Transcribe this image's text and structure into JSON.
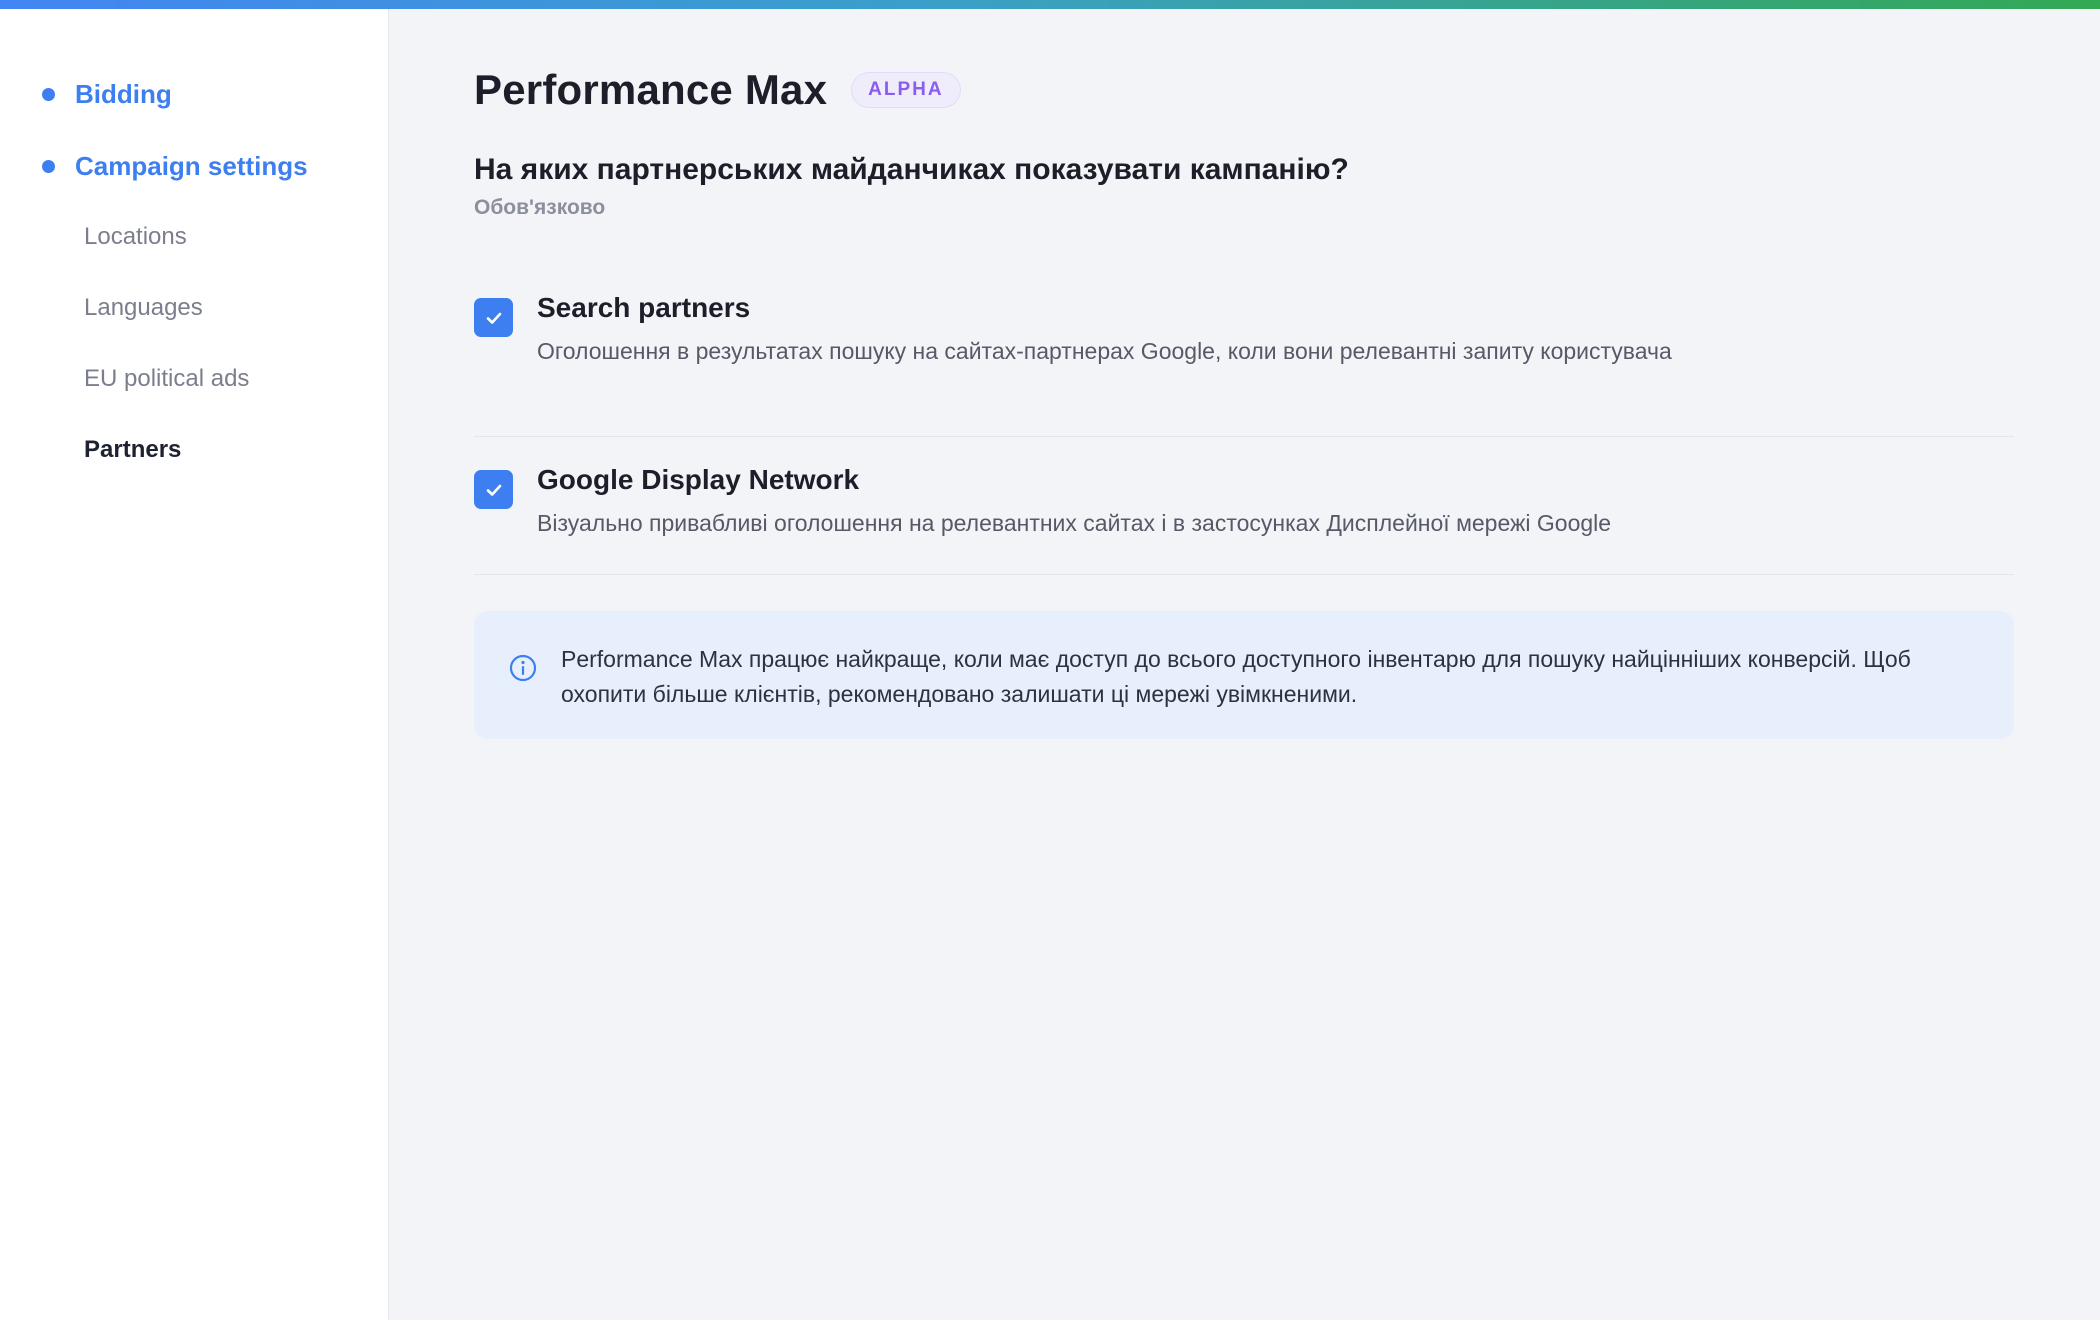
{
  "sidebar": {
    "sections": [
      {
        "label": "Bidding"
      },
      {
        "label": "Campaign settings"
      }
    ],
    "items": [
      {
        "label": "Locations"
      },
      {
        "label": "Languages"
      },
      {
        "label": "EU political ads"
      },
      {
        "label": "Partners"
      }
    ],
    "active_item": "Partners"
  },
  "main": {
    "title": "Performance Max",
    "badge": "ALPHA",
    "question": "На яких партнерських майданчиках показувати кампанію?",
    "required_label": "Обов'язково",
    "options": [
      {
        "title": "Search partners",
        "description": "Оголошення в результатах пошуку на сайтах-партнерах Google, коли вони релевантні запиту користувача",
        "checked": true
      },
      {
        "title": "Google Display Network",
        "description": "Візуально привабливі оголошення на релевантних сайтах і в застосунках Дисплейної мережі Google",
        "checked": true
      }
    ],
    "info": {
      "icon": "info-icon",
      "text": "Performance Max працює найкраще, коли має доступ до всього доступного інвентарю для пошуку найцінніших конверсій. Щоб охопити більше клієнтів, рекомендовано залишати ці мережі увімкненими."
    }
  },
  "colors": {
    "accent": "#3d7ff0",
    "badge_text": "#8a5cf0",
    "info_background": "#e8effc"
  }
}
